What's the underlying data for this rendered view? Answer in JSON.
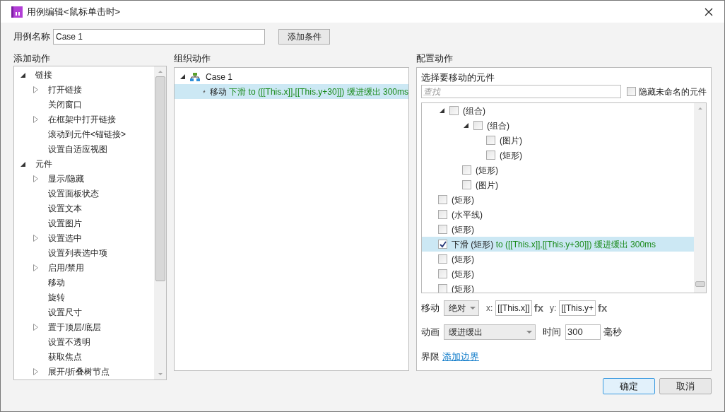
{
  "window": {
    "title": "用例编辑<鼠标单击时>"
  },
  "case_name": {
    "label": "用例名称",
    "value": "Case 1",
    "button": "添加条件"
  },
  "add_actions": {
    "title": "添加动作",
    "items": [
      {
        "label": "链接",
        "kind": "folder",
        "expanded": true,
        "children": [
          {
            "label": "打开链接",
            "kind": "folder",
            "expanded": false
          },
          {
            "label": "关闭窗口",
            "kind": "leaf"
          },
          {
            "label": "在框架中打开链接",
            "kind": "folder",
            "expanded": false
          },
          {
            "label": "滚动到元件<锚链接>",
            "kind": "leaf"
          },
          {
            "label": "设置自适应视图",
            "kind": "leaf"
          }
        ]
      },
      {
        "label": "元件",
        "kind": "folder",
        "expanded": true,
        "children": [
          {
            "label": "显示/隐藏",
            "kind": "folder",
            "expanded": false
          },
          {
            "label": "设置面板状态",
            "kind": "leaf"
          },
          {
            "label": "设置文本",
            "kind": "leaf"
          },
          {
            "label": "设置图片",
            "kind": "leaf"
          },
          {
            "label": "设置选中",
            "kind": "folder",
            "expanded": false
          },
          {
            "label": "设置列表选中项",
            "kind": "leaf"
          },
          {
            "label": "启用/禁用",
            "kind": "folder",
            "expanded": false
          },
          {
            "label": "移动",
            "kind": "leaf"
          },
          {
            "label": "旋转",
            "kind": "leaf"
          },
          {
            "label": "设置尺寸",
            "kind": "leaf"
          },
          {
            "label": "置于顶层/底层",
            "kind": "folder",
            "expanded": false
          },
          {
            "label": "设置不透明",
            "kind": "leaf"
          },
          {
            "label": "获取焦点",
            "kind": "leaf"
          },
          {
            "label": "展开/折叠树节点",
            "kind": "folder",
            "expanded": false
          }
        ]
      }
    ]
  },
  "organize_actions": {
    "title": "组织动作",
    "cases": [
      {
        "label": "Case 1",
        "expanded": true,
        "actions": [
          {
            "verb": "移动",
            "detail": "下滑 to ([[This.x]],[[This.y+30]]) 缓进缓出 300ms",
            "selected": true
          }
        ]
      }
    ]
  },
  "configure": {
    "title": "配置动作",
    "subtitle": "选择要移动的元件",
    "search": {
      "placeholder": "查找"
    },
    "hide_unnamed": {
      "label": "隐藏未命名的元件",
      "checked": false
    },
    "widgets": [
      {
        "name": "(组合)",
        "kind": "group",
        "expanded": true,
        "checked": false,
        "selected": false,
        "children": [
          {
            "name": "(组合)",
            "kind": "group",
            "expanded": true,
            "checked": false,
            "selected": false,
            "children": [
              {
                "name": "(图片)",
                "kind": "leaf",
                "checked": false,
                "selected": false
              },
              {
                "name": "(矩形)",
                "kind": "leaf",
                "checked": false,
                "selected": false
              }
            ]
          },
          {
            "name": "(矩形)",
            "kind": "leaf",
            "checked": false,
            "selected": false
          },
          {
            "name": "(图片)",
            "kind": "leaf",
            "checked": false,
            "selected": false
          }
        ]
      },
      {
        "name": "(矩形)",
        "kind": "leaf",
        "checked": false,
        "selected": false
      },
      {
        "name": "(水平线)",
        "kind": "leaf",
        "checked": false,
        "selected": false
      },
      {
        "name": "(矩形)",
        "kind": "leaf",
        "checked": false,
        "selected": false
      },
      {
        "prefix": "下滑",
        "name": "(矩形)",
        "detail": "to ([[This.x]],[[This.y+30]]) 缓进缓出 300ms",
        "kind": "leaf",
        "checked": true,
        "selected": true
      },
      {
        "name": "(矩形)",
        "kind": "leaf",
        "checked": false,
        "selected": false
      },
      {
        "name": "(矩形)",
        "kind": "leaf",
        "checked": false,
        "selected": false
      },
      {
        "name": "(矩形)",
        "kind": "leaf",
        "checked": false,
        "selected": false
      }
    ],
    "move": {
      "label": "移动",
      "mode": "绝对",
      "x_label": "x:",
      "x": "[[This.x]]",
      "x_fx": "fx",
      "y_label": "y:",
      "y": "[[This.y+",
      "y_fx": "fx"
    },
    "animation": {
      "label": "动画",
      "value": "缓进缓出",
      "time_label": "时间",
      "time": "300",
      "unit": "毫秒"
    },
    "bounds": {
      "label": "界限",
      "link": "添加边界"
    }
  },
  "buttons": [
    {
      "label": "确定",
      "kind": "primary"
    },
    {
      "label": "取消",
      "kind": "normal"
    }
  ]
}
